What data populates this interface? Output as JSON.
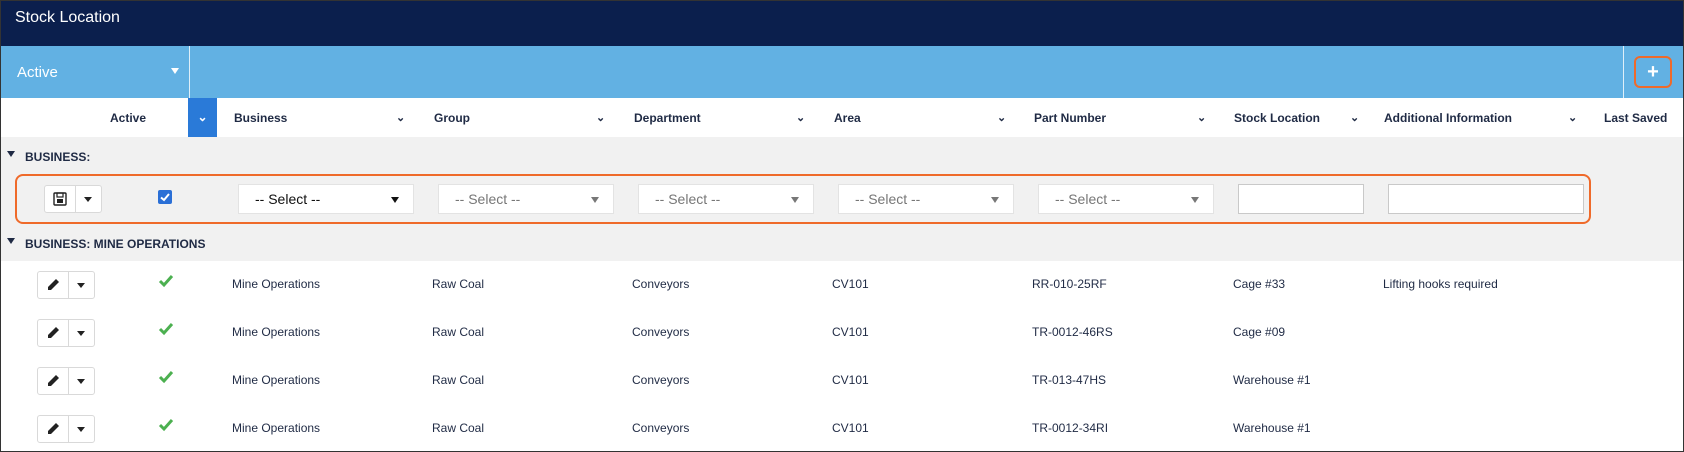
{
  "app": {
    "title": "Stock Location"
  },
  "filter": {
    "status_value": "Active",
    "add_label": "+"
  },
  "columns": [
    {
      "key": "active",
      "label": "Active"
    },
    {
      "key": "business",
      "label": "Business"
    },
    {
      "key": "group",
      "label": "Group"
    },
    {
      "key": "department",
      "label": "Department"
    },
    {
      "key": "area",
      "label": "Area"
    },
    {
      "key": "part_number",
      "label": "Part Number"
    },
    {
      "key": "stock_location",
      "label": "Stock Location"
    },
    {
      "key": "additional_information",
      "label": "Additional Information"
    },
    {
      "key": "last_saved",
      "label": "Last Saved"
    }
  ],
  "groups": {
    "new_group": "BUSINESS:",
    "mine_group": "BUSINESS: MINE OPERATIONS"
  },
  "new_row": {
    "active_checked": true,
    "business": "-- Select --",
    "group": "-- Select --",
    "department": "-- Select --",
    "area": "-- Select --",
    "part_number": "-- Select --",
    "stock_location": "",
    "additional_information": ""
  },
  "rows": [
    {
      "active": true,
      "business": "Mine Operations",
      "group": "Raw Coal",
      "department": "Conveyors",
      "area": "CV101",
      "part_number": "RR-010-25RF",
      "stock_location": "Cage #33",
      "additional_information": "Lifting hooks required",
      "last_saved": ""
    },
    {
      "active": true,
      "business": "Mine Operations",
      "group": "Raw Coal",
      "department": "Conveyors",
      "area": "CV101",
      "part_number": "TR-0012-46RS",
      "stock_location": "Cage #09",
      "additional_information": "",
      "last_saved": ""
    },
    {
      "active": true,
      "business": "Mine Operations",
      "group": "Raw Coal",
      "department": "Conveyors",
      "area": "CV101",
      "part_number": "TR-013-47HS",
      "stock_location": "Warehouse #1",
      "additional_information": "",
      "last_saved": ""
    },
    {
      "active": true,
      "business": "Mine Operations",
      "group": "Raw Coal",
      "department": "Conveyors",
      "area": "CV101",
      "part_number": "TR-0012-34RI",
      "stock_location": "Warehouse #1",
      "additional_information": "",
      "last_saved": ""
    }
  ],
  "colors": {
    "title_bg": "#0b1f4d",
    "filter_bg": "#62b1e3",
    "accent": "#2a7ad8",
    "highlight": "#ef6a2a",
    "check_green": "#4cb050"
  },
  "icons": [
    "caret-down-icon",
    "plus-icon",
    "chevron-down-icon",
    "save-icon",
    "pencil-icon",
    "checkbox-icon",
    "checkmark-icon"
  ]
}
